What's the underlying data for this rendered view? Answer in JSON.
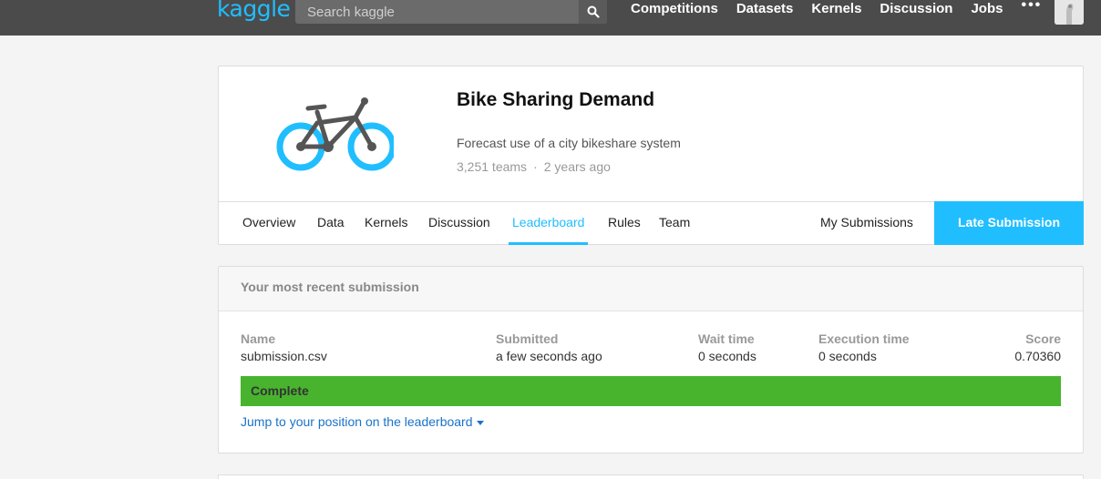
{
  "topbar": {
    "logo": "kaggle",
    "search_placeholder": "Search kaggle",
    "nav": [
      "Competitions",
      "Datasets",
      "Kernels",
      "Discussion",
      "Jobs"
    ],
    "more": "•••"
  },
  "competition": {
    "title": "Bike Sharing Demand",
    "description": "Forecast use of a city bikeshare system",
    "teams": "3,251 teams",
    "separator": "·",
    "age": "2 years ago",
    "tabs": [
      "Overview",
      "Data",
      "Kernels",
      "Discussion",
      "Leaderboard",
      "Rules",
      "Team"
    ],
    "active_tab": "Leaderboard",
    "my_submissions": "My Submissions",
    "late_submission": "Late Submission",
    "accent": "#20beff"
  },
  "submission": {
    "heading": "Your most recent submission",
    "columns": [
      {
        "header": "Name",
        "value": "submission.csv"
      },
      {
        "header": "Submitted",
        "value": "a few seconds ago"
      },
      {
        "header": "Wait time",
        "value": "0 seconds"
      },
      {
        "header": "Execution time",
        "value": "0 seconds"
      },
      {
        "header": "Score",
        "value": "0.70360"
      }
    ],
    "status": "Complete",
    "status_color": "#48b42e",
    "jump_link": "Jump to your position on the leaderboard"
  }
}
